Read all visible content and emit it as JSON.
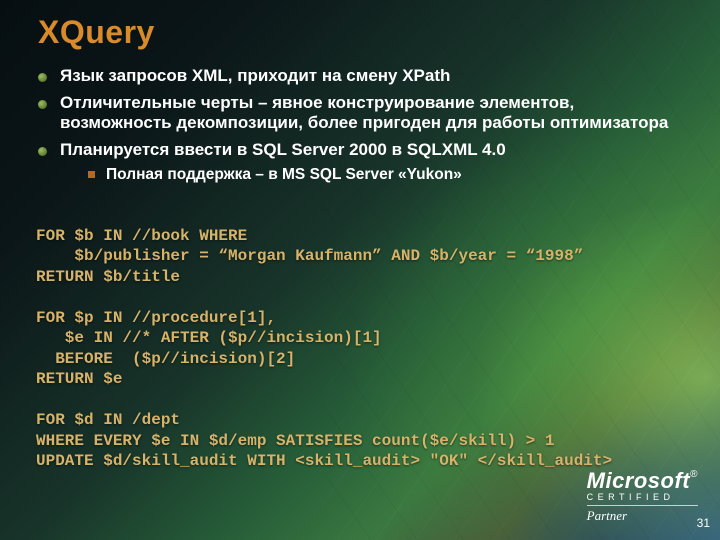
{
  "title": "XQuery",
  "bullets": [
    "Язык запросов XML, приходит на смену XPath",
    "Отличительные черты – явное конструирование элементов, возможность декомпозиции, более пригоден для работы оптимизатора",
    "Планируется ввести в SQL Server 2000 в SQLXML 4.0"
  ],
  "sub_bullet": "Полная поддержка – в MS SQL Server «Yukon»",
  "code": "FOR $b IN //book WHERE\n    $b/publisher = “Morgan Kaufmann” AND $b/year = “1998”\nRETURN $b/title\n\nFOR $p IN //procedure[1],\n   $e IN //* AFTER ($p//incision)[1]\n  BEFORE  ($p//incision)[2]\nRETURN $e\n\nFOR $d IN /dept\nWHERE EVERY $e IN $d/emp SATISFIES count($e/skill) > 1\nUPDATE $d/skill_audit WITH <skill_audit> \"OK\" </skill_audit>",
  "logo": {
    "brand": "Microsoft",
    "certified": "CERTIFIED",
    "partner": "Partner"
  },
  "page_number": "31"
}
